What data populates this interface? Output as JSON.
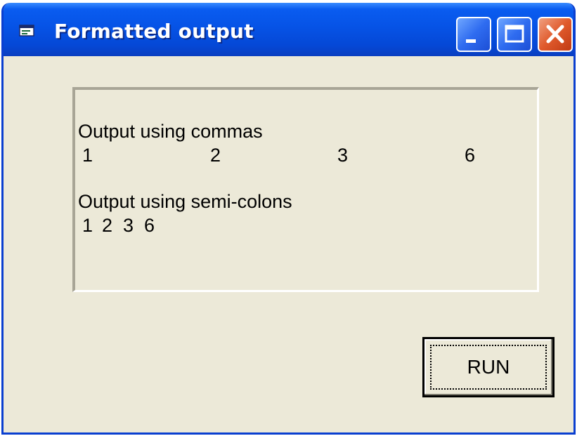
{
  "window": {
    "title": "Formatted output",
    "icon": "app-form-icon",
    "controls": [
      "minimize-icon",
      "maximize-icon",
      "close-icon"
    ]
  },
  "output": {
    "commas_label": "Output using commas",
    "commas_values": [
      "1",
      "2",
      "3",
      "6"
    ],
    "semicolons_label": "Output using semi-colons",
    "semicolons_values": [
      "1",
      "2",
      "3",
      "6"
    ]
  },
  "buttons": {
    "run_label": "RUN"
  },
  "colors": {
    "titlebar": "#0653e6",
    "window_face": "#ece9d8",
    "close_button": "#e05a2c"
  }
}
